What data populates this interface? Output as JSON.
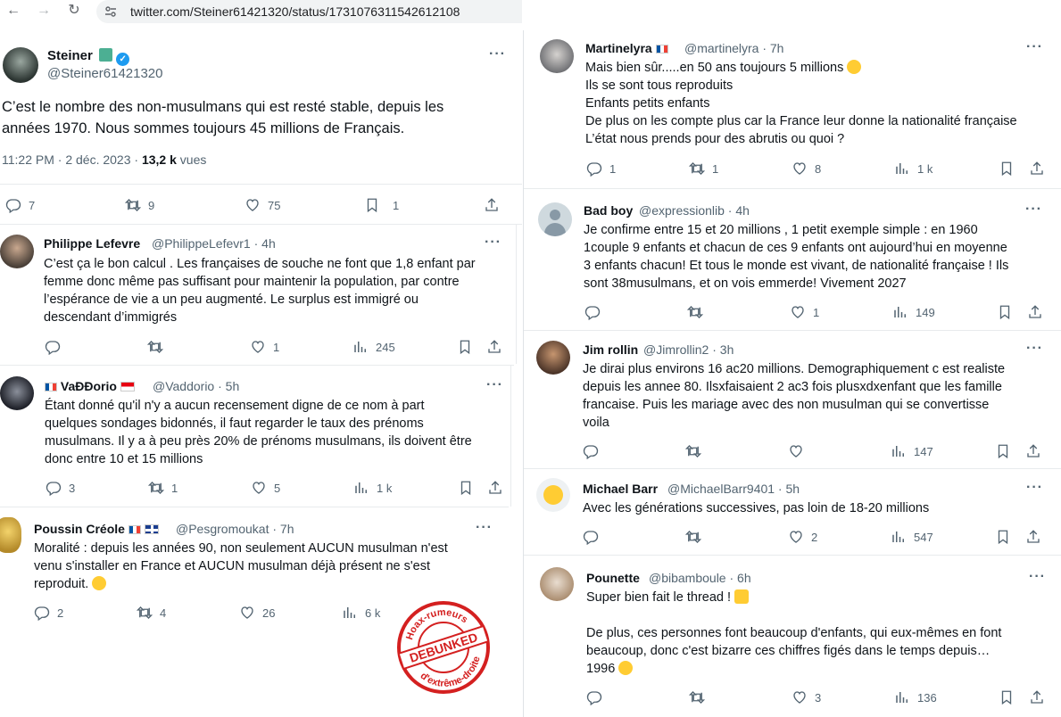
{
  "browser": {
    "url": "twitter.com/Steiner61421320/status/1731076311542612108"
  },
  "main_tweet": {
    "name": "Steiner",
    "handle": "@Steiner61421320",
    "text_lines": [
      "C’est le nombre des non-musulmans qui est resté stable, depuis les",
      "années 1970. Nous sommes toujours 45 millions de Français."
    ],
    "time": "11:22 PM · 2 déc. 2023 · ",
    "views_count": "13,2 k",
    "views_label": " vues",
    "stats": {
      "replies": "7",
      "retweets": "9",
      "likes": "75",
      "bookmarks": "1"
    }
  },
  "left_replies": [
    {
      "name": "Philippe Lefevre",
      "handle": "@PhilippeLefevr1 · 4h",
      "lines": [
        "C’est ça le bon calcul . Les françaises de souche ne font que 1,8 enfant par",
        "femme donc même pas suffisant pour maintenir la population, par contre",
        "l’espérance de vie a un peu augmenté. Le surplus est immigré ou",
        "descendant d’immigrés"
      ],
      "replies": "",
      "retweets": "",
      "likes": "1",
      "views": "245"
    },
    {
      "name": "VaÐÐorio",
      "handle": "@Vaddorio · 5h",
      "lines": [
        "Étant donné qu'il n'y a aucun recensement digne de ce nom à part",
        "quelques sondages bidonnés,  il faut regarder le taux des prénoms",
        "musulmans. Il y a à peu près 20% de prénoms musulmans, ils doivent être",
        "donc entre 10 et 15 millions"
      ],
      "replies": "3",
      "retweets": "1",
      "likes": "5",
      "views": "1 k"
    },
    {
      "name": "Poussin Créole",
      "handle": "@Pesgromoukat · 7h",
      "lines": [
        "Moralité : depuis les années 90, non seulement AUCUN musulman n'est",
        "venu s'installer en France et AUCUN musulman déjà présent ne s'est",
        "reproduit."
      ],
      "replies": "2",
      "retweets": "4",
      "likes": "26",
      "views": "6 k"
    }
  ],
  "right_replies": [
    {
      "name": "Martinelyra",
      "handle": "@martinelyra · 7h",
      "lines": [
        "Mais bien sûr.....en 50 ans toujours 5 millions",
        "Ils se sont tous reproduits",
        "Enfants petits enfants",
        "De plus on les compte plus car la France leur donne la nationalité française",
        "L’état nous prends pour des abrutis ou quoi ?"
      ],
      "replies": "1",
      "retweets": "1",
      "likes": "8",
      "views": "1 k"
    },
    {
      "name": "Bad boy",
      "handle": "@expressionlib · 4h",
      "lines": [
        "Je confirme entre 15 et 20 millions , 1 petit exemple simple : en 1960",
        "1couple  9 enfants et chacun de ces 9 enfants ont aujourd’hui en moyenne",
        "3 enfants chacun! Et tous le monde est vivant, de nationalité française ! Ils",
        "sont 38musulmans, et on vois emmerde! Vivement 2027"
      ],
      "replies": "",
      "retweets": "",
      "likes": "1",
      "views": "149"
    },
    {
      "name": "Jim rollin",
      "handle": "@Jimrollin2 · 3h",
      "lines": [
        "Je dirai plus environs 16 ac20 millions. Demographiquement c est realiste",
        "depuis les annee 80. Ilsxfaisaient 2 ac3 fois plusxdxenfant que les famille",
        "francaise. Puis les mariage avec des non musulman qui se convertisse",
        "voila"
      ],
      "replies": "",
      "retweets": "",
      "likes": "",
      "views": "147"
    },
    {
      "name": "Michael Barr",
      "handle": "@MichaelBarr9401 · 5h",
      "lines": [
        "Avec les générations successives, pas loin de 18-20 millions"
      ],
      "replies": "",
      "retweets": "",
      "likes": "2",
      "views": "547"
    },
    {
      "name": "Pounette",
      "handle": "@bibamboule · 6h",
      "lines": [
        "Super bien fait le thread !",
        "",
        "De plus, ces personnes font beaucoup d'enfants, qui eux-mêmes en font",
        "beaucoup, donc c'est bizarre ces chiffres figés dans le temps depuis…",
        "1996"
      ],
      "replies": "",
      "retweets": "",
      "likes": "3",
      "views": "136"
    }
  ],
  "stamp": {
    "top_text": "Hoax-rumeurs",
    "center_text": "DEBUNKED",
    "bottom_text": "d'extrême-droite"
  },
  "colors": {
    "verified": "#1d9bf0",
    "muted": "#536471",
    "stamp_red": "#d42020"
  }
}
